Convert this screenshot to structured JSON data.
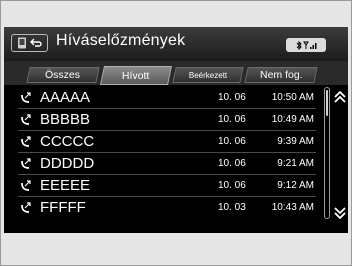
{
  "window": {
    "title": "Hívás­előzmények"
  },
  "header": {
    "title": "Híváselőzmények",
    "status_icons": [
      "bluetooth-icon",
      "signal-strength-icon"
    ]
  },
  "tabs": [
    {
      "label": "Összes"
    },
    {
      "label": "Hívott"
    },
    {
      "label": "Beérkezett"
    },
    {
      "label": "Nem fog."
    }
  ],
  "active_tab": "Hívott",
  "calls": [
    {
      "name": "AAAAA",
      "date": "10. 06",
      "time": "10:50 AM"
    },
    {
      "name": "BBBBB",
      "date": "10. 06",
      "time": "10:49 AM"
    },
    {
      "name": "CCCCC",
      "date": "10. 06",
      "time": "9:39 AM"
    },
    {
      "name": "DDDDD",
      "date": "10. 06",
      "time": "9:21 AM"
    },
    {
      "name": "EEEEE",
      "date": "10. 06",
      "time": "9:12 AM"
    },
    {
      "name": "FFFFF",
      "date": "10. 03",
      "time": "10:43 AM"
    }
  ],
  "icons": {
    "row_icon": "outgoing-call-icon",
    "scroll_up": "double-chevron-up-icon",
    "scroll_down": "double-chevron-down-icon"
  },
  "colors": {
    "screen_bg": "#000000",
    "text": "#ffffff",
    "frame": "#e6e6e6"
  }
}
